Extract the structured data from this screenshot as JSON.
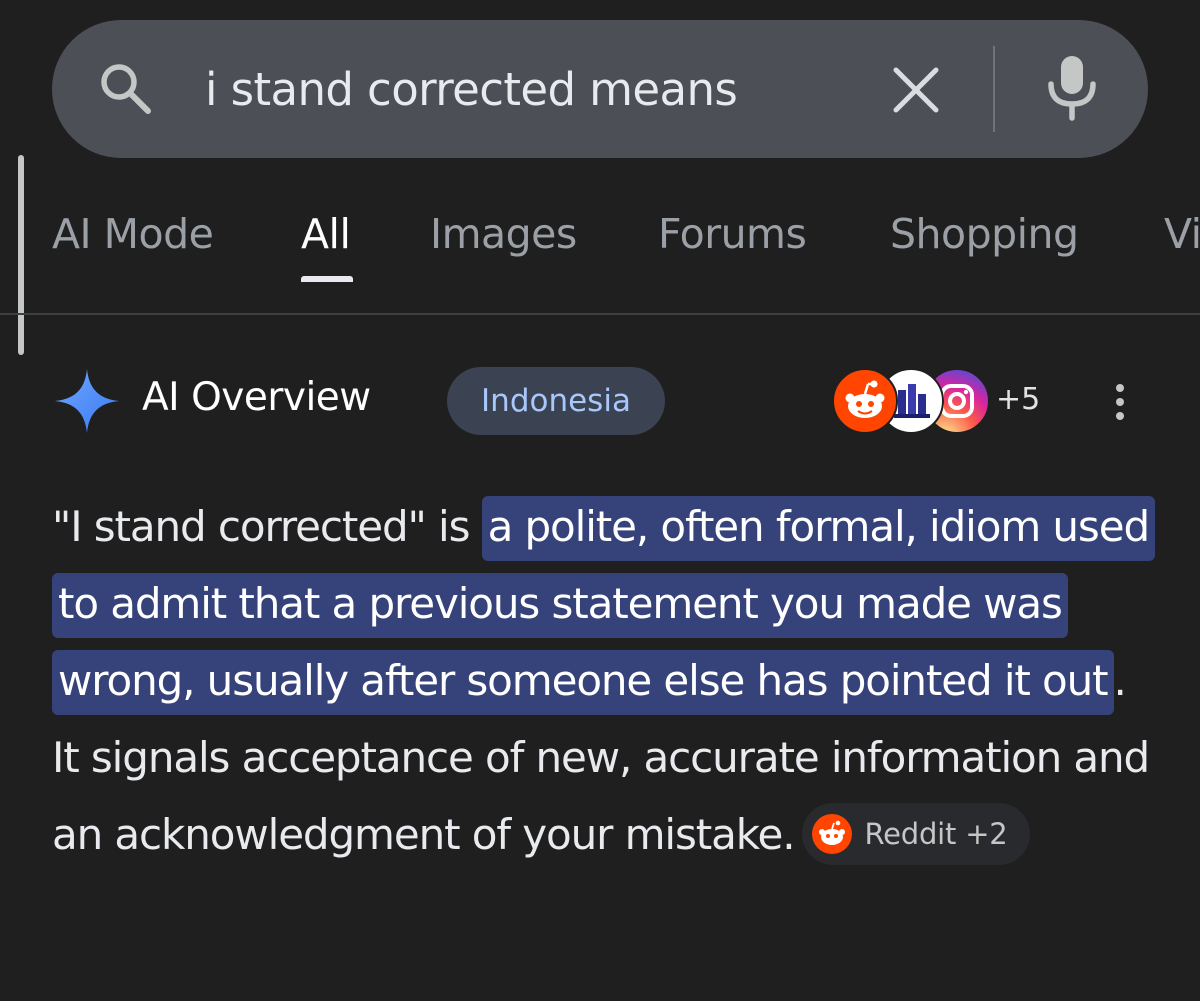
{
  "search": {
    "query": "i stand corrected means"
  },
  "tabs": [
    {
      "label": "AI Mode",
      "active": false
    },
    {
      "label": "All",
      "active": true
    },
    {
      "label": "Images",
      "active": false
    },
    {
      "label": "Forums",
      "active": false
    },
    {
      "label": "Shopping",
      "active": false
    },
    {
      "label": "Vi",
      "active": false
    }
  ],
  "ai_overview": {
    "title": "AI Overview",
    "country_chip": "Indonesia",
    "source_icons": [
      "reddit-icon",
      "site-icon",
      "instagram-icon"
    ],
    "more_sources": "+5",
    "answer": {
      "intro": "\"I stand corrected\" is ",
      "highlight": "a polite, often formal, idiom used to admit that a previous statement you made was wrong, usually after someone else has pointed it out",
      "rest": ". It signals acceptance of new, accurate information and an acknowledgment of your mistake.",
      "source_chip": "Reddit +2"
    }
  },
  "colors": {
    "background": "#1f1f1f",
    "search_bar": "#4c4f56",
    "highlight": "#36427a",
    "chip_text": "#a8c7fa",
    "sparkle": "#4c8df6"
  }
}
